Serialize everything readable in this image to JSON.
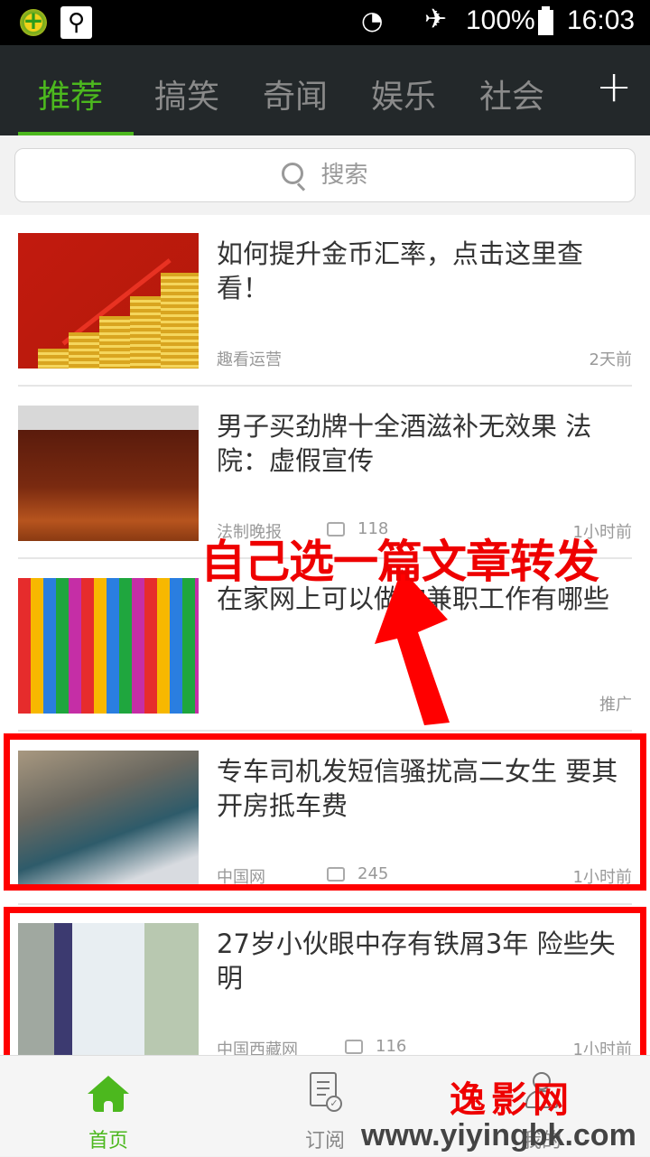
{
  "status_bar": {
    "time": "16:03",
    "battery": "100%",
    "icons": [
      "360-security-icon",
      "usb-icon",
      "wifi-icon",
      "airplane-mode-icon",
      "battery-icon"
    ]
  },
  "top_nav": {
    "tabs": [
      {
        "label": "推荐",
        "active": true
      },
      {
        "label": "搞笑",
        "active": false
      },
      {
        "label": "奇闻",
        "active": false
      },
      {
        "label": "娱乐",
        "active": false
      },
      {
        "label": "社会",
        "active": false
      }
    ],
    "add_label": "+"
  },
  "search": {
    "placeholder": "搜索"
  },
  "articles": [
    {
      "title": "如何提升金币汇率，点击这里查看！",
      "source": "趣看运营",
      "comments": "",
      "time": "2天前"
    },
    {
      "title": "男子买劲牌十全酒滋补无效果 法院：虚假宣传",
      "source": "法制晚报",
      "comments": "118",
      "time": "1小时前"
    },
    {
      "title": "在家网上可以做的兼职工作有哪些",
      "source": "",
      "comments": "",
      "time": "推广"
    },
    {
      "title": "专车司机发短信骚扰高二女生 要其开房抵车费",
      "source": "中国网",
      "comments": "245",
      "time": "1小时前"
    },
    {
      "title": "27岁小伙眼中存有铁屑3年 险些失明",
      "source": "中国西藏网",
      "comments": "116",
      "time": "1小时前"
    }
  ],
  "annotation": {
    "text": "自己选一篇文章转发",
    "color": "#ee0000"
  },
  "bottom_nav": {
    "tabs": [
      {
        "label": "首页",
        "active": true
      },
      {
        "label": "订阅",
        "active": false
      },
      {
        "label": "我的",
        "active": false
      }
    ]
  },
  "watermark": {
    "name": "逸影网",
    "url": "www.yiyingbk.com"
  },
  "colors": {
    "accent": "#4cb81e",
    "nav_bg": "#23282a",
    "annotation_red": "#ff0000"
  }
}
